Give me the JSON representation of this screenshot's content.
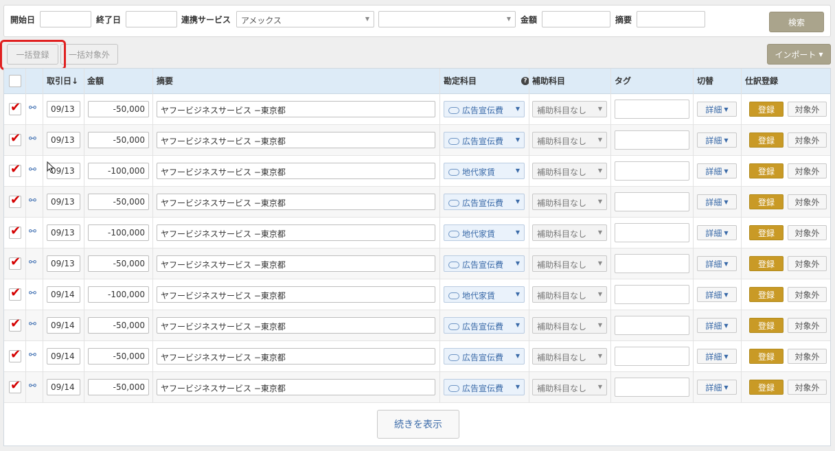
{
  "filters": {
    "start_label": "開始日",
    "end_label": "終了日",
    "service_label": "連携サービス",
    "service_value": "アメックス",
    "service2_value": "",
    "amount_label": "金額",
    "summary_label": "摘要",
    "search_button": "検索"
  },
  "actions": {
    "bulk_register": "一括登録",
    "bulk_exclude": "一括対象外",
    "import": "インポート"
  },
  "table": {
    "headers": {
      "date": "取引日",
      "amount": "金額",
      "summary": "摘要",
      "account": "勘定科目",
      "subaccount": "補助科目",
      "tag": "タグ",
      "toggle": "切替",
      "journal": "仕訳登録"
    },
    "detail_label": "詳細",
    "register_label": "登録",
    "exclude_label": "対象外",
    "subaccount_value": "補助科目なし",
    "rows": [
      {
        "date": "09/13",
        "amount": "-50,000",
        "summary": "ヤフービジネスサービス −東京都",
        "account": "広告宣伝費"
      },
      {
        "date": "09/13",
        "amount": "-50,000",
        "summary": "ヤフービジネスサービス −東京都",
        "account": "広告宣伝費"
      },
      {
        "date": "09/13",
        "amount": "-100,000",
        "summary": "ヤフービジネスサービス −東京都",
        "account": "地代家賃"
      },
      {
        "date": "09/13",
        "amount": "-50,000",
        "summary": "ヤフービジネスサービス −東京都",
        "account": "広告宣伝費"
      },
      {
        "date": "09/13",
        "amount": "-100,000",
        "summary": "ヤフービジネスサービス −東京都",
        "account": "地代家賃"
      },
      {
        "date": "09/13",
        "amount": "-50,000",
        "summary": "ヤフービジネスサービス −東京都",
        "account": "広告宣伝費"
      },
      {
        "date": "09/14",
        "amount": "-100,000",
        "summary": "ヤフービジネスサービス −東京都",
        "account": "地代家賃"
      },
      {
        "date": "09/14",
        "amount": "-50,000",
        "summary": "ヤフービジネスサービス −東京都",
        "account": "広告宣伝費"
      },
      {
        "date": "09/14",
        "amount": "-50,000",
        "summary": "ヤフービジネスサービス −東京都",
        "account": "広告宣伝費"
      },
      {
        "date": "09/14",
        "amount": "-50,000",
        "summary": "ヤフービジネスサービス −東京都",
        "account": "広告宣伝費"
      }
    ]
  },
  "more_button": "続きを表示"
}
